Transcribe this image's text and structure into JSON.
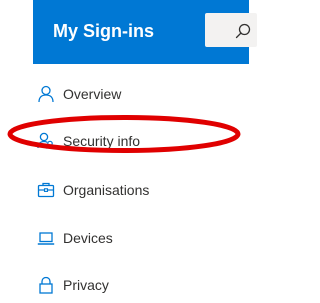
{
  "header": {
    "title": "My Sign-ins",
    "search_icon": "search-icon"
  },
  "nav": {
    "items": [
      {
        "label": "Overview",
        "icon": "person-icon"
      },
      {
        "label": "Security info",
        "icon": "person-key-icon"
      },
      {
        "label": "Organisations",
        "icon": "briefcase-icon"
      },
      {
        "label": "Devices",
        "icon": "laptop-icon"
      },
      {
        "label": "Privacy",
        "icon": "lock-icon"
      }
    ]
  },
  "annotation": {
    "highlight_color": "#e00000",
    "highlighted_item": "Security info"
  },
  "colors": {
    "accent": "#0078d4",
    "icon": "#0078d4",
    "text": "#323130"
  }
}
